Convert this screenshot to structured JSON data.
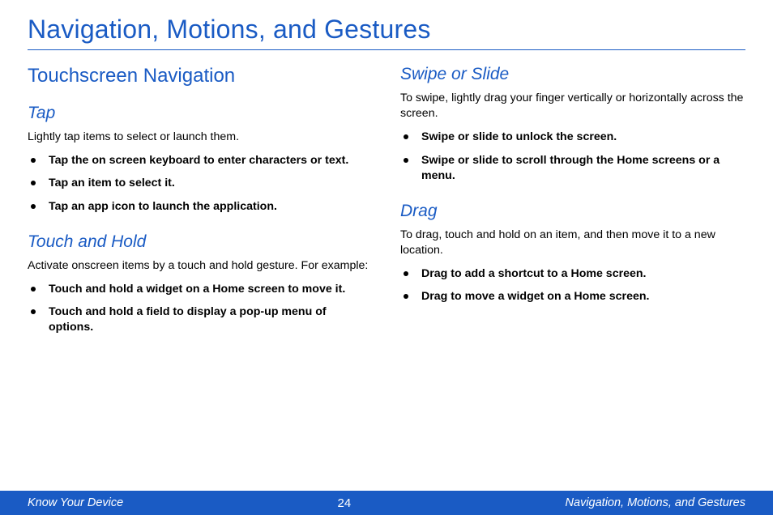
{
  "title": "Navigation, Motions, and Gestures",
  "left": {
    "h2": "Touchscreen Navigation",
    "tap": {
      "h3": "Tap",
      "intro": "Lightly tap items to select or launch them.",
      "items": [
        "Tap the on screen keyboard to enter characters or text.",
        "Tap an item to select it.",
        "Tap an app icon to launch the application."
      ]
    },
    "touchhold": {
      "h3": "Touch and Hold",
      "intro": "Activate onscreen items by a touch and hold gesture. For example:",
      "items": [
        "Touch and hold a widget on a Home screen to move it.",
        "Touch and hold a field to display a pop-up menu of options."
      ]
    }
  },
  "right": {
    "swipe": {
      "h3": "Swipe or Slide",
      "intro": "To swipe, lightly drag your finger vertically or horizontally across the screen.",
      "items": [
        "Swipe or slide to unlock the screen.",
        "Swipe or slide to scroll through the Home screens or a menu."
      ]
    },
    "drag": {
      "h3": "Drag",
      "intro": "To drag, touch and hold on an item, and then move it to a new location.",
      "items": [
        "Drag to add a shortcut to a Home screen.",
        "Drag to move a widget on a Home screen."
      ]
    }
  },
  "footer": {
    "left": "Know Your Device",
    "page": "24",
    "right": "Navigation, Motions, and Gestures"
  }
}
